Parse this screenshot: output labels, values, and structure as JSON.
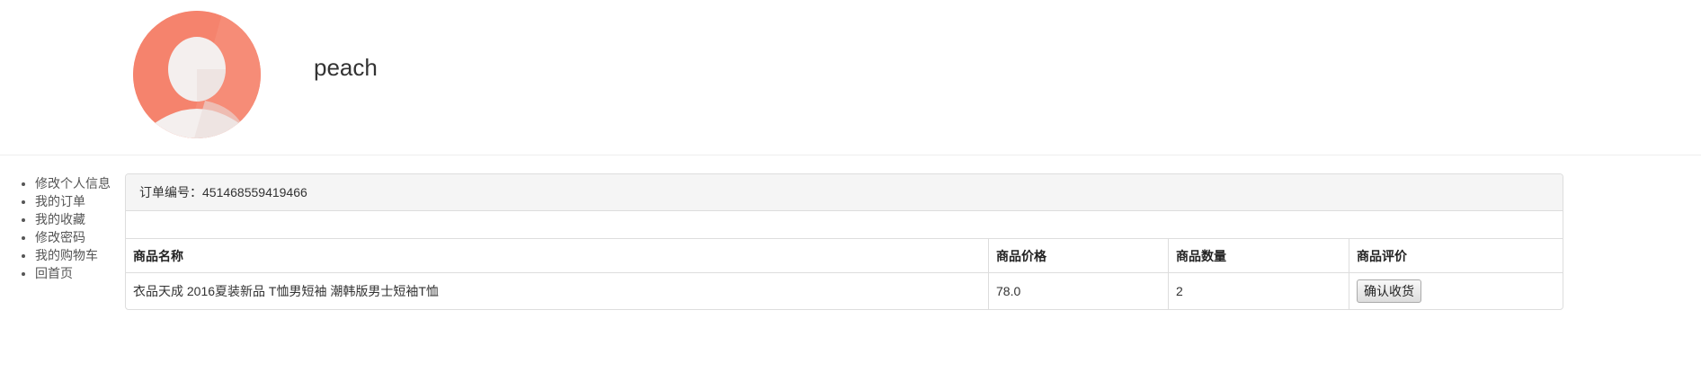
{
  "user": {
    "name": "peach"
  },
  "sidebar": {
    "items": [
      {
        "label": "修改个人信息"
      },
      {
        "label": "我的订单"
      },
      {
        "label": "我的收藏"
      },
      {
        "label": "修改密码"
      },
      {
        "label": "我的购物车"
      },
      {
        "label": "回首页"
      }
    ]
  },
  "order": {
    "number_label": "订单编号：451468559419466",
    "table": {
      "headers": [
        "商品名称",
        "商品价格",
        "商品数量",
        "商品评价"
      ],
      "rows": [
        {
          "name": "衣品天成 2016夏装新品 T恤男短袖 潮韩版男士短袖T恤",
          "price": "78.0",
          "quantity": "2",
          "action_label": "确认收货"
        }
      ]
    }
  },
  "colors": {
    "avatar_bg": "#f5836d",
    "panel_heading_bg": "#f5f5f5",
    "border": "#dddddd"
  }
}
